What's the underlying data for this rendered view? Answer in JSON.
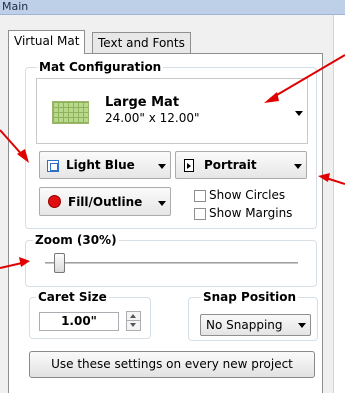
{
  "window": {
    "title": "Main"
  },
  "tabs": [
    {
      "label": "Virtual Mat",
      "active": true
    },
    {
      "label": "Text and Fonts",
      "active": false
    }
  ],
  "mat_configuration": {
    "legend": "Mat Configuration",
    "mat_name": "Large Mat",
    "mat_size": "24.00\" x 12.00\"",
    "color_label": "Light Blue",
    "orientation_label": "Portrait",
    "fill_label": "Fill/Outline",
    "show_circles": {
      "label": "Show Circles",
      "checked": false
    },
    "show_margins": {
      "label": "Show Margins",
      "checked": false
    }
  },
  "zoom": {
    "legend": "Zoom (30%)",
    "value_percent": 30
  },
  "caret_size": {
    "legend": "Caret Size",
    "value": "1.00\""
  },
  "snap_position": {
    "legend": "Snap Position",
    "selected": "No Snapping"
  },
  "footer": {
    "apply_button": "Use these settings on every new project"
  },
  "colors": {
    "annotation_arrow": "#e00000",
    "accent_blue": "#2f6fc7",
    "fill_red": "#e01010"
  }
}
